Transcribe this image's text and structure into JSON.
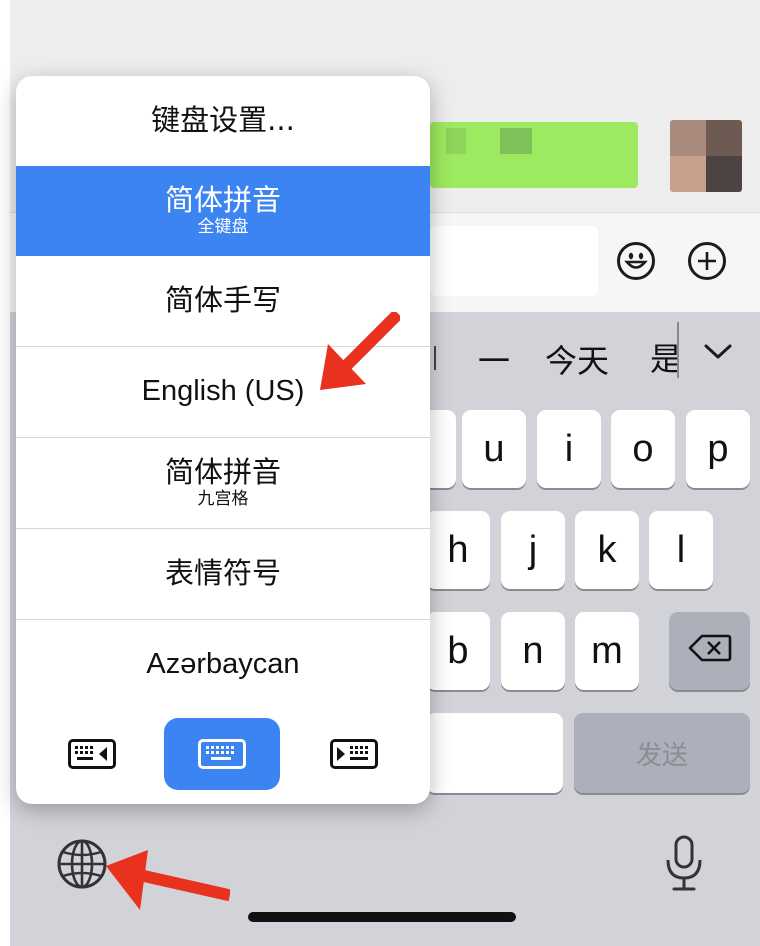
{
  "menu": {
    "items": [
      {
        "title": "键盘设置...",
        "subtitle": ""
      },
      {
        "title": "简体拼音",
        "subtitle": "全键盘",
        "selected": true
      },
      {
        "title": "简体手写",
        "subtitle": ""
      },
      {
        "title": "English (US)",
        "subtitle": ""
      },
      {
        "title": "简体拼音",
        "subtitle": "九宫格"
      },
      {
        "title": "表情符号",
        "subtitle": ""
      },
      {
        "title": "Azərbaycan",
        "subtitle": ""
      }
    ],
    "layout_buttons": [
      "keyboard-left-icon",
      "keyboard-full-icon",
      "keyboard-right-icon"
    ],
    "accent_color": "#3d84f3"
  },
  "candidates": {
    "items": [
      "一",
      "今天",
      "是"
    ],
    "expand_icon": "chevron-down-icon"
  },
  "keys": {
    "row1": [
      "u",
      "i",
      "o",
      "p"
    ],
    "row2": [
      "h",
      "j",
      "k",
      "l"
    ],
    "row3": [
      "b",
      "n",
      "m"
    ],
    "send_label": "发送",
    "delete_icon": "backspace-icon"
  },
  "icons": {
    "emoji": "smiley-icon",
    "add": "plus-circle-icon",
    "globe": "globe-icon",
    "mic": "microphone-icon"
  },
  "annotations": {
    "arrow_color": "#e8321e"
  }
}
